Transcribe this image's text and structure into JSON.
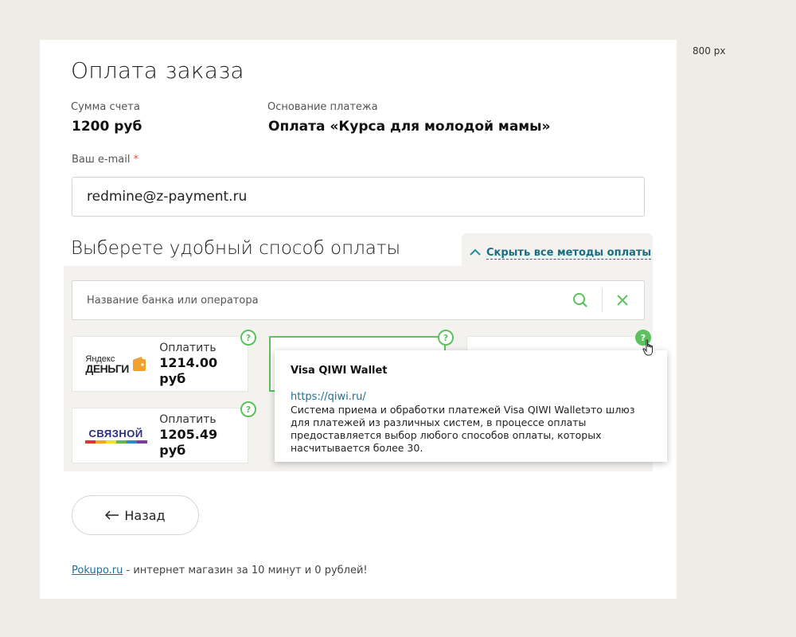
{
  "annotation": {
    "size_note": "800 px"
  },
  "page": {
    "title": "Оплата заказа",
    "amount_label": "Сумма счета",
    "amount_value": "1200 руб",
    "basis_label": "Основание платежа",
    "basis_value": "Оплата «Курса для молодой мамы»",
    "email_label": "Ваш e-mail",
    "email_required_mark": "*",
    "email_value": "redmine@z-payment.ru"
  },
  "payment": {
    "section_title": "Выберете удобный способ оплаты",
    "hide_methods_label": "Скрыть все методы оплаты",
    "search_placeholder": "Название банка или оператора",
    "methods": [
      {
        "logo": "Яндекс Деньги",
        "pay_label": "Оплатить",
        "amount": "1214.00 руб",
        "help": "?"
      },
      {
        "logo": "Visa QIWI Wallet",
        "help": "?",
        "selected": true
      },
      {
        "logo": "",
        "help": "?"
      },
      {
        "logo": "Связной",
        "pay_label": "Оплатить",
        "amount": "1205.49 руб",
        "help": "?"
      }
    ],
    "logo_texts": {
      "yandex_top": "Яндекс",
      "yandex_bottom": "ДЕНЬГИ",
      "svyaznoy": "СВЯЗНОЙ"
    }
  },
  "tooltip": {
    "title": "Visa QIWI Wallet",
    "link": "https://qiwi.ru/",
    "description": "Система приема и обработки платежей Visa QIWI Walletэто шлюз для платежей из различных систем, в процессе оплаты предоставляется выбор любого способов оплаты, которых насчитывается более 30."
  },
  "nav": {
    "back_label": "Назад"
  },
  "footer": {
    "link_text": "Pokupo.ru",
    "text": " - интернет магазин за 10 минут и 0 рублей!"
  },
  "colors": {
    "accent_green": "#5cc15e",
    "link_blue": "#1a6c85",
    "page_bg": "#efece6"
  }
}
